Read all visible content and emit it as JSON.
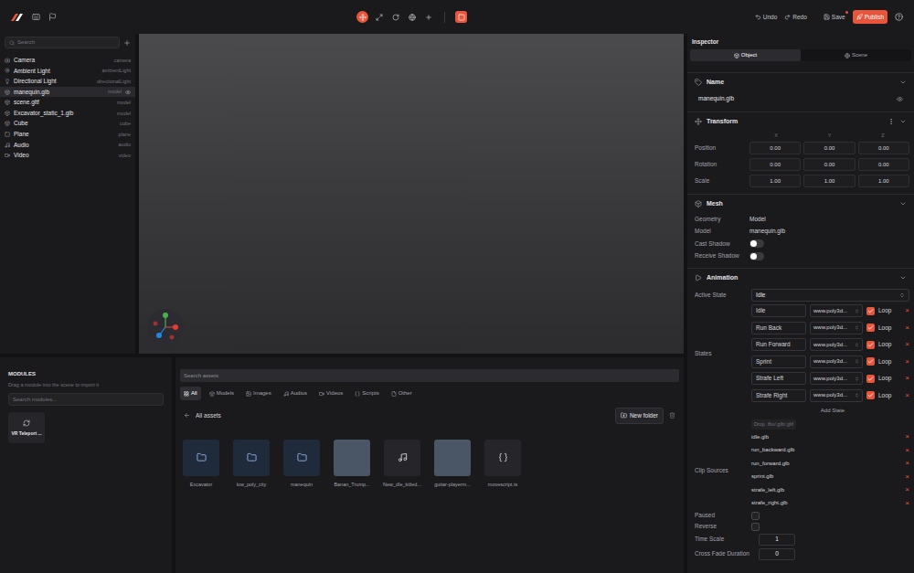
{
  "topbar": {
    "toolbar": [
      {
        "selected": true
      },
      {
        "selected": false
      },
      {
        "selected": false
      },
      {
        "selected": false
      },
      {
        "selected": false
      },
      {
        "selected": true
      }
    ],
    "undo": "Undo",
    "redo": "Redo",
    "save": {
      "label": "Save",
      "unsaved": true
    },
    "publish": "Publish"
  },
  "hierarchy": {
    "search": {
      "placeholder": "Search"
    },
    "items": [
      {
        "name": "Camera",
        "type": "camera",
        "selected": false
      },
      {
        "name": "Ambient Light",
        "type": "ambientLight",
        "selected": false
      },
      {
        "name": "Directional Light",
        "type": "directionalLight",
        "selected": false
      },
      {
        "name": "manequin.glb",
        "type": "model",
        "selected": true
      },
      {
        "name": "scene.gltf",
        "type": "model",
        "selected": false
      },
      {
        "name": "Excavator_static_1.glb",
        "type": "model",
        "selected": false
      },
      {
        "name": "Cube",
        "type": "cube",
        "selected": false
      },
      {
        "name": "Plane",
        "type": "plane",
        "selected": false
      },
      {
        "name": "Audio",
        "type": "audio",
        "selected": false
      },
      {
        "name": "Video",
        "type": "video",
        "selected": false
      }
    ]
  },
  "modules": {
    "title": "MODULES",
    "hint": "Drag a module into the scene to import it",
    "search": {
      "placeholder": "Search modules..."
    },
    "items": [
      {
        "name": "VR Teleport ..."
      }
    ]
  },
  "assets": {
    "search": {
      "placeholder": "Search assets"
    },
    "filters": [
      {
        "label": "All",
        "selected": true
      },
      {
        "label": "Models",
        "selected": false
      },
      {
        "label": "Images",
        "selected": false
      },
      {
        "label": "Audios",
        "selected": false
      },
      {
        "label": "Videos",
        "selected": false
      },
      {
        "label": "Scripts",
        "selected": false
      },
      {
        "label": "Other",
        "selected": false
      }
    ],
    "breadcrumb": "All assets",
    "new_folder": "New folder",
    "items": [
      {
        "name": "Excavator",
        "kind": "folder"
      },
      {
        "name": "low_poly_city",
        "kind": "folder"
      },
      {
        "name": "manequin",
        "kind": "folder"
      },
      {
        "name": "Banan_Trump...",
        "kind": "image"
      },
      {
        "name": "New_dle_kitled...",
        "kind": "audio"
      },
      {
        "name": "guitar-playerm...",
        "kind": "image"
      },
      {
        "name": "movescript.ts",
        "kind": "script"
      }
    ]
  },
  "inspector": {
    "title": "Inspector",
    "tabs": [
      {
        "label": "Object",
        "selected": true
      },
      {
        "label": "Scene",
        "selected": false
      }
    ],
    "name": {
      "header": "Name",
      "value": "manequin.glb"
    },
    "transform": {
      "header": "Transform",
      "axes": [
        "X",
        "Y",
        "Z"
      ],
      "rows": [
        {
          "label": "Position",
          "values": [
            "0.00",
            "0.00",
            "0.00"
          ]
        },
        {
          "label": "Rotation",
          "values": [
            "0.00",
            "0.00",
            "0.00"
          ]
        },
        {
          "label": "Scale",
          "values": [
            "1.00",
            "1.00",
            "1.00"
          ]
        }
      ]
    },
    "mesh": {
      "header": "Mesh",
      "rows": [
        {
          "label": "Geometry",
          "kind": "text",
          "value": "Model"
        },
        {
          "label": "Model",
          "kind": "text",
          "value": "manequin.glb"
        },
        {
          "label": "Cast Shadow",
          "kind": "toggle",
          "on": false
        },
        {
          "label": "Receive Shadow",
          "kind": "toggle",
          "on": false
        }
      ]
    },
    "animation": {
      "header": "Animation",
      "active_state": {
        "label": "Active State",
        "value": "Idle"
      },
      "states_label": "States",
      "states": [
        {
          "name": "Idle",
          "source": "www.poly3d...",
          "loop": true,
          "loop_label": "Loop",
          "remove": "×"
        },
        {
          "name": "Run Back",
          "source": "www.poly3d...",
          "loop": true,
          "loop_label": "Loop",
          "remove": "×"
        },
        {
          "name": "Run Forward",
          "source": "www.poly3d...",
          "loop": true,
          "loop_label": "Loop",
          "remove": "×"
        },
        {
          "name": "Sprint",
          "source": "www.poly3d...",
          "loop": true,
          "loop_label": "Loop",
          "remove": "×"
        },
        {
          "name": "Strafe Left",
          "source": "www.poly3d...",
          "loop": true,
          "loop_label": "Loop",
          "remove": "×"
        },
        {
          "name": "Strafe Right",
          "source": "www.poly3d...",
          "loop": true,
          "loop_label": "Loop",
          "remove": "×"
        }
      ],
      "add_state": "Add State",
      "drop_placeholder": "Drop .fbx/.glb/.gltf",
      "clip_sources_label": "Clip Sources",
      "clip_sources": [
        {
          "name": "idle.glb",
          "remove": "×"
        },
        {
          "name": "run_backward.glb",
          "remove": "×"
        },
        {
          "name": "run_forward.glb",
          "remove": "×"
        },
        {
          "name": "sprint.glb",
          "remove": "×"
        },
        {
          "name": "strafe_left.glb",
          "remove": "×"
        },
        {
          "name": "strafe_right.glb",
          "remove": "×"
        }
      ],
      "paused": {
        "label": "Paused",
        "checked": false
      },
      "reverse": {
        "label": "Reverse",
        "checked": false
      },
      "time_scale": {
        "label": "Time Scale",
        "value": "1"
      },
      "cross_fade": {
        "label": "Cross Fade Duration",
        "value": "0"
      }
    }
  }
}
